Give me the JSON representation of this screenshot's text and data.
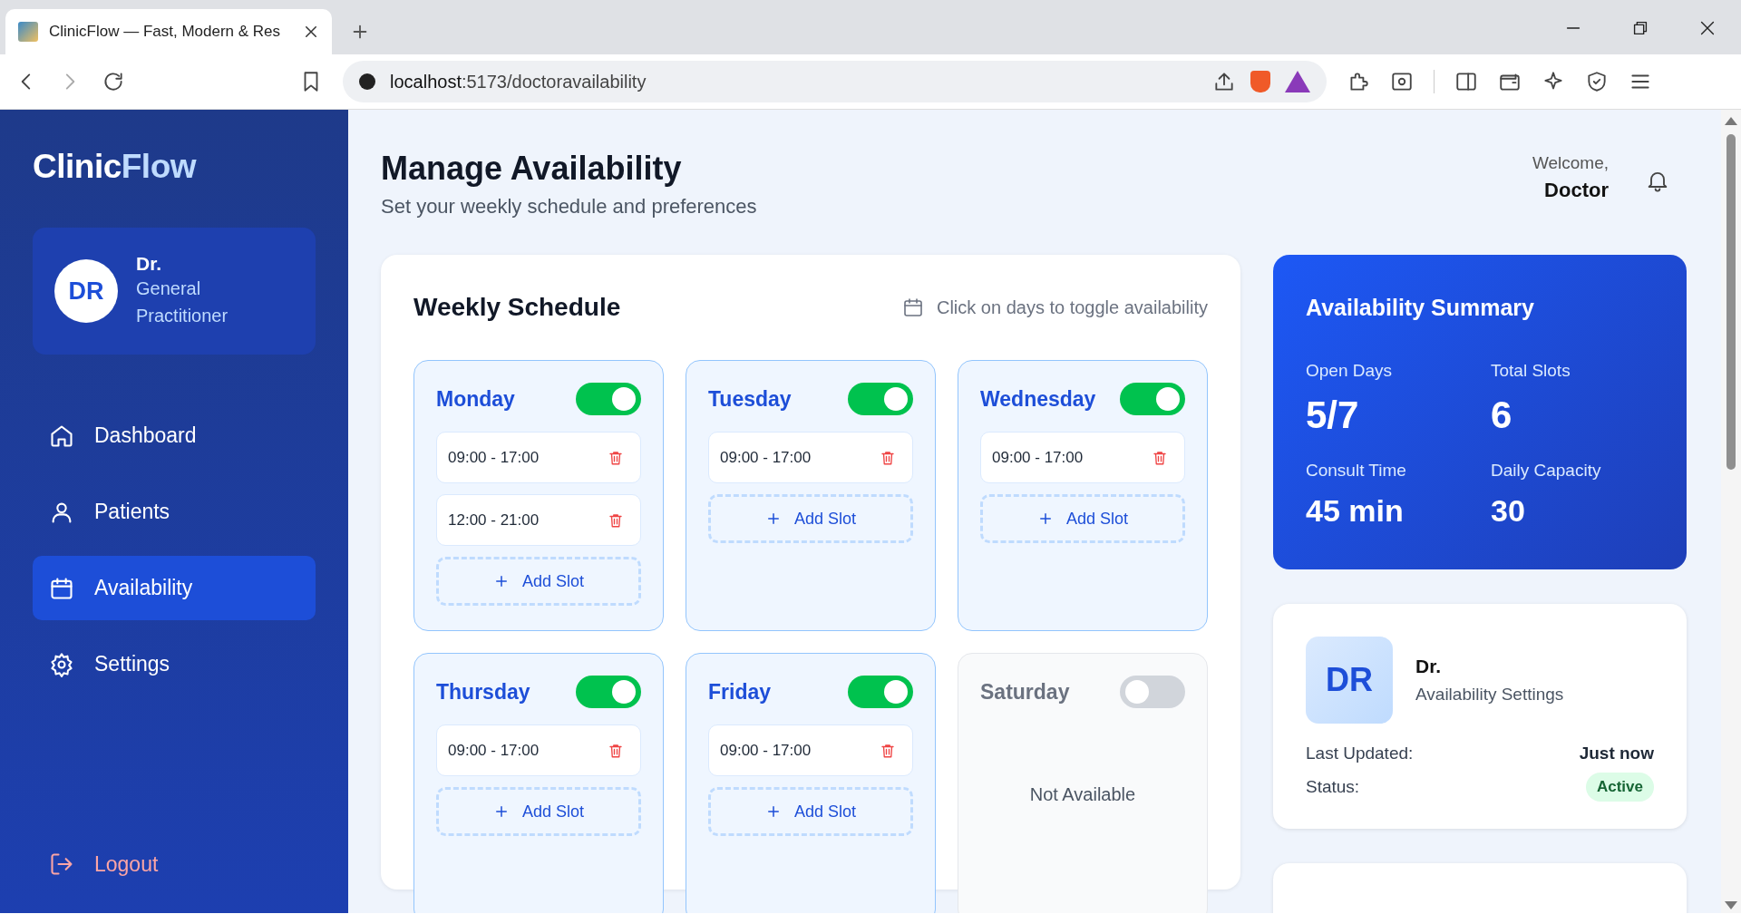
{
  "browser": {
    "tab_title": "ClinicFlow — Fast, Modern & Res",
    "url_host": "localhost",
    "url_path": ":5173/doctoravailability"
  },
  "sidebar": {
    "logo": [
      {
        "text": "Clinic",
        "kind": "plain"
      },
      {
        "text": "Flow",
        "kind": "accent"
      }
    ],
    "profile": {
      "initials": "DR",
      "name": "Dr.",
      "role": "General Practitioner"
    },
    "items": [
      {
        "label": "Dashboard",
        "selected": false
      },
      {
        "label": "Patients",
        "selected": false
      },
      {
        "label": "Availability",
        "selected": true
      },
      {
        "label": "Settings",
        "selected": false
      }
    ],
    "logout": "Logout"
  },
  "header": {
    "title": "Manage Availability",
    "subtitle": "Set your weekly schedule and preferences",
    "welcome": "Welcome,",
    "user": "Doctor"
  },
  "schedule": {
    "title": "Weekly Schedule",
    "hint": "Click on days to toggle availability",
    "days": [
      {
        "name": "Monday",
        "on": true,
        "slots": [
          "09:00 - 17:00",
          "12:00 - 21:00"
        ],
        "add_label": "Add Slot"
      },
      {
        "name": "Tuesday",
        "on": true,
        "slots": [
          "09:00 - 17:00"
        ],
        "add_label": "Add Slot"
      },
      {
        "name": "Wednesday",
        "on": true,
        "slots": [
          "09:00 - 17:00"
        ],
        "add_label": "Add Slot"
      },
      {
        "name": "Thursday",
        "on": true,
        "slots": [
          "09:00 - 17:00"
        ],
        "add_label": "Add Slot"
      },
      {
        "name": "Friday",
        "on": true,
        "slots": [
          "09:00 - 17:00"
        ],
        "add_label": "Add Slot"
      },
      {
        "name": "Saturday",
        "on": false,
        "empty_text": "Not Available"
      }
    ]
  },
  "summary": {
    "title": "Availability Summary",
    "stats": [
      {
        "label": "Open Days",
        "value": "5/7"
      },
      {
        "label": "Total Slots",
        "value": "6"
      },
      {
        "label": "Consult Time",
        "value": "45 min"
      },
      {
        "label": "Daily Capacity",
        "value": "30"
      }
    ]
  },
  "profile_card": {
    "initials": "DR",
    "name": "Dr.",
    "subtitle": "Availability Settings",
    "rows": [
      {
        "label": "Last Updated:",
        "value": "Just now",
        "kind": "text"
      },
      {
        "label": "Status:",
        "value": "Active",
        "kind": "badge"
      }
    ]
  }
}
